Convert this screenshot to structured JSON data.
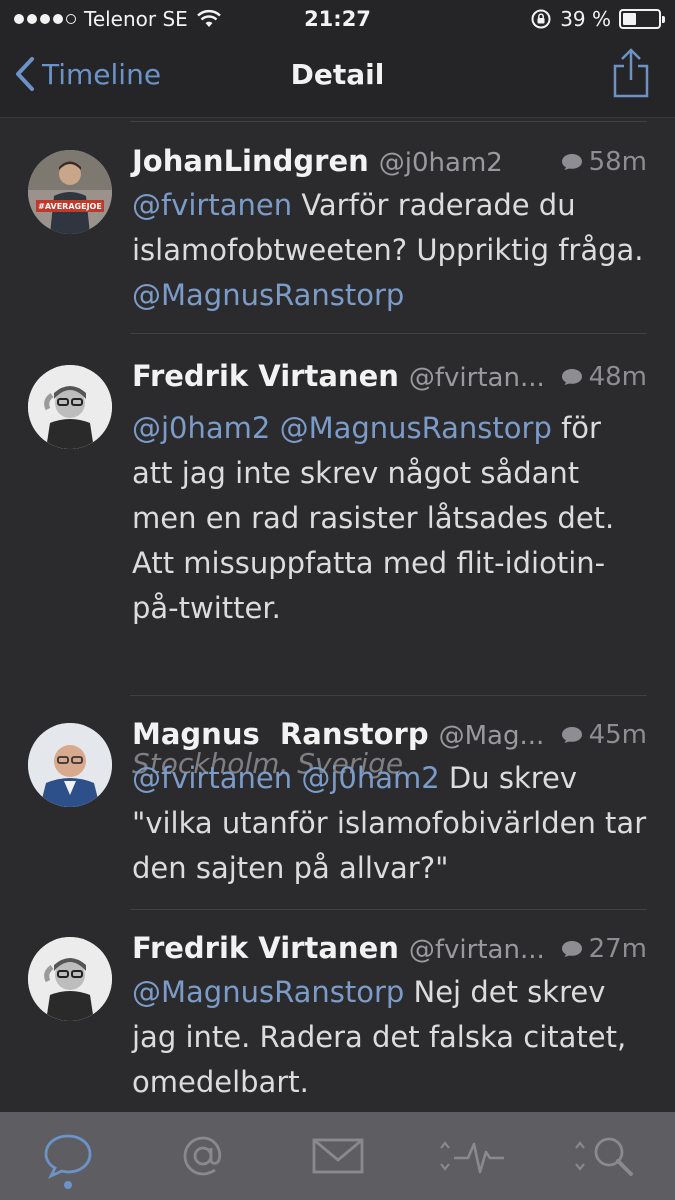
{
  "status_bar": {
    "carrier": "Telenor SE",
    "time": "21:27",
    "battery_percent_text": "39 %",
    "battery_level": 0.39
  },
  "nav": {
    "back_label": "Timeline",
    "title": "Detail"
  },
  "tweets": [
    {
      "name": "JohanLindgren",
      "handle": "@j0ham2",
      "time": "58m",
      "avatar_text": "#AVERAGEJOE",
      "body": [
        {
          "t": "@fvirtanen",
          "m": true
        },
        {
          "t": " Varför raderade du islamofobtweeten? Uppriktig fråga. ",
          "m": false
        },
        {
          "t": "@MagnusRanstorp",
          "m": true
        }
      ]
    },
    {
      "name": "Fredrik Virtanen",
      "handle": "@fvirtan...",
      "time": "48m",
      "location": "Stockholm, Sverige",
      "body": [
        {
          "t": "@j0ham2",
          "m": true
        },
        {
          "t": " ",
          "m": false
        },
        {
          "t": "@MagnusRanstorp",
          "m": true
        },
        {
          "t": " för att jag inte skrev något sådant men en rad rasister låtsades det. Att missuppfatta med flit-idiotin-på-twitter.",
          "m": false
        }
      ]
    },
    {
      "name": "Magnus  Ranstorp",
      "handle": "@Mag...",
      "time": "45m",
      "body": [
        {
          "t": "@fvirtanen",
          "m": true
        },
        {
          "t": " ",
          "m": false
        },
        {
          "t": "@j0ham2",
          "m": true
        },
        {
          "t": " Du skrev \"vilka utanför islamofobivärlden tar den sajten på allvar?\"",
          "m": false
        }
      ]
    },
    {
      "name": "Fredrik Virtanen",
      "handle": "@fvirtan...",
      "time": "27m",
      "body": [
        {
          "t": "@MagnusRanstorp",
          "m": true
        },
        {
          "t": " Nej det skrev jag inte. Radera det falska citatet, omedelbart.",
          "m": false
        }
      ]
    }
  ],
  "tabs": [
    {
      "icon": "speech-bubble-icon",
      "active": true
    },
    {
      "icon": "at-sign-icon",
      "active": false
    },
    {
      "icon": "envelope-icon",
      "active": false
    },
    {
      "icon": "activity-icon",
      "active": false
    },
    {
      "icon": "search-icon",
      "active": false
    }
  ],
  "colors": {
    "accent": "#6c93c7",
    "background": "#2b2b2d",
    "tabbar": "#5e5e62"
  }
}
